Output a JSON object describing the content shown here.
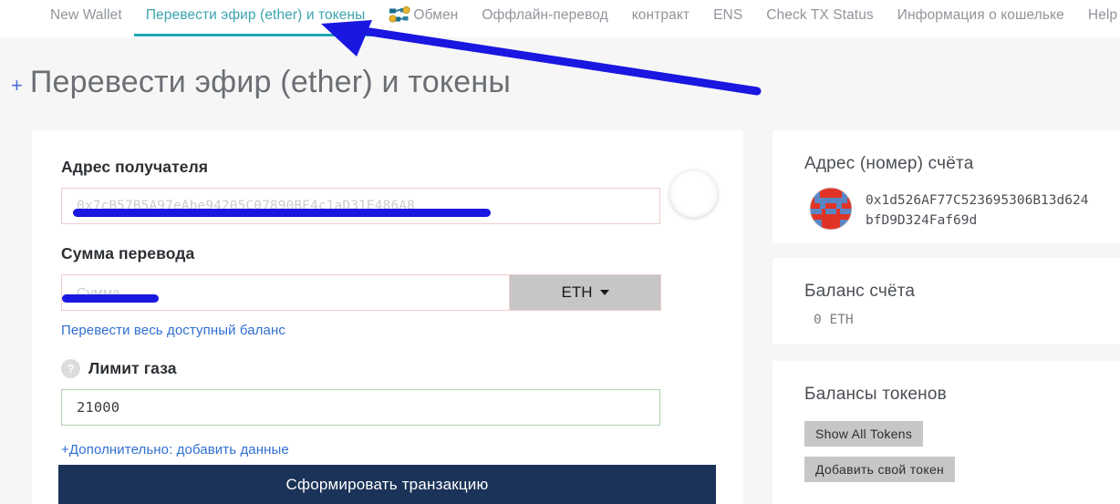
{
  "nav": {
    "items": [
      {
        "label": "New Wallet",
        "active": false,
        "icon": null
      },
      {
        "label": "Перевести эфир (ether) и токены",
        "active": true,
        "icon": null
      },
      {
        "label": "Обмен",
        "active": false,
        "icon": "swap-icon"
      },
      {
        "label": "Оффлайн-перевод",
        "active": false,
        "icon": null
      },
      {
        "label": "контракт",
        "active": false,
        "icon": null
      },
      {
        "label": "ENS",
        "active": false,
        "icon": null
      },
      {
        "label": "Check TX Status",
        "active": false,
        "icon": null
      },
      {
        "label": "Информация о кошельке",
        "active": false,
        "icon": null
      },
      {
        "label": "Help",
        "active": false,
        "icon": null
      }
    ]
  },
  "page": {
    "plus": "+",
    "title": "Перевести эфир (ether) и токены"
  },
  "form": {
    "address_label": "Адрес получателя",
    "address_placeholder": "0x7cB57B5A97eAbe94205C07890BE4c1aD31E486A8",
    "address_value": "",
    "amount_label": "Сумма перевода",
    "amount_placeholder": "Сумма",
    "amount_value": "",
    "currency_selected": "ETH",
    "send_all_link": "Перевести весь доступный баланс",
    "gas_label": "Лимит газа",
    "gas_value": "21000",
    "help_glyph": "?",
    "advanced_link": "+Дополнительно: добавить данные",
    "submit_label": "Сформировать транзакцию"
  },
  "sidebar": {
    "address_panel": {
      "title": "Адрес (номер) счёта",
      "address": "0x1d526AF77C523695306B13d624bfD9D324Faf69d"
    },
    "balance_panel": {
      "title": "Баланс счёта",
      "value": "0 ETH"
    },
    "tokens_panel": {
      "title": "Балансы токенов",
      "show_all_label": "Show All Tokens",
      "add_custom_label": "Добавить свой токен"
    }
  },
  "colors": {
    "accent_teal": "#25a4b0",
    "nav_text": "#90959b",
    "annotation_blue": "#1a17e0",
    "submit_navy": "#1b3358",
    "page_bg": "#f6f6f6",
    "error_border": "#f0cccb",
    "valid_border": "#adcfad"
  }
}
